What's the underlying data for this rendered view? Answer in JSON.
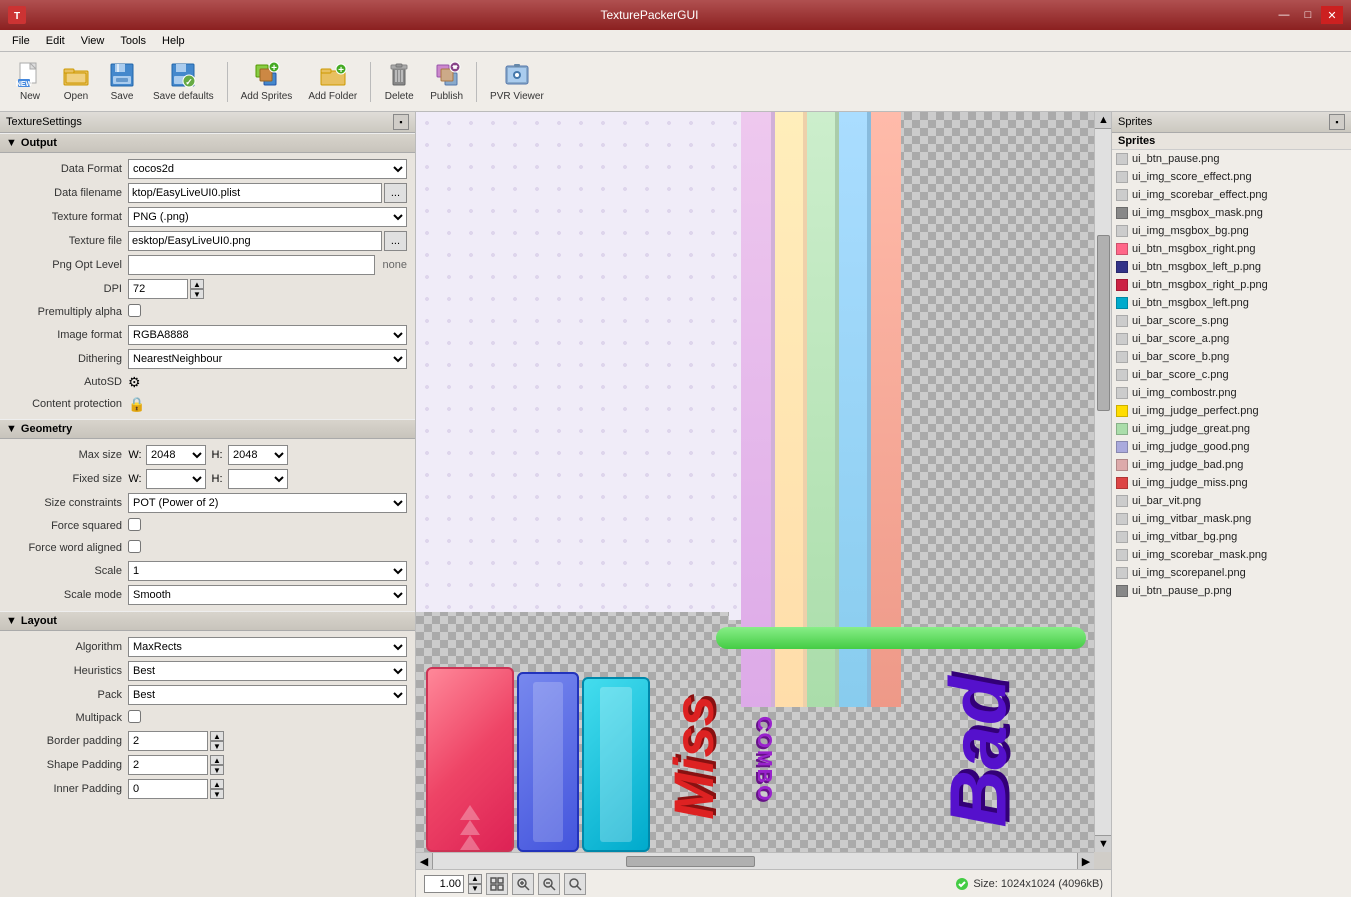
{
  "app": {
    "title": "TexturePackerGUI",
    "icon": "T"
  },
  "titlebar": {
    "minimize": "—",
    "maximize": "□",
    "close": "✕"
  },
  "menubar": {
    "items": [
      "File",
      "Edit",
      "View",
      "Tools",
      "Help"
    ]
  },
  "toolbar": {
    "buttons": [
      {
        "id": "new",
        "label": "New"
      },
      {
        "id": "open",
        "label": "Open"
      },
      {
        "id": "save",
        "label": "Save"
      },
      {
        "id": "save-defaults",
        "label": "Save defaults"
      },
      {
        "id": "add-sprites",
        "label": "Add Sprites"
      },
      {
        "id": "add-folder",
        "label": "Add Folder"
      },
      {
        "id": "delete",
        "label": "Delete"
      },
      {
        "id": "publish",
        "label": "Publish"
      },
      {
        "id": "pvr-viewer",
        "label": "PVR Viewer"
      }
    ]
  },
  "texture_settings": {
    "panel_title": "TextureSettings",
    "sections": {
      "output": {
        "label": "Output",
        "fields": {
          "data_format": {
            "label": "Data Format",
            "value": "cocos2d"
          },
          "data_filename": {
            "label": "Data filename",
            "value": "ktop/EasyLiveUI0.plist"
          },
          "texture_format": {
            "label": "Texture format",
            "value": "PNG (.png)"
          },
          "texture_file": {
            "label": "Texture file",
            "value": "esktop/EasyLiveUI0.png"
          },
          "png_opt_level": {
            "label": "Png Opt Level",
            "value": "",
            "suffix": "none"
          },
          "dpi": {
            "label": "DPI",
            "value": "72"
          },
          "premultiply_alpha": {
            "label": "Premultiply alpha",
            "checked": false
          },
          "image_format": {
            "label": "Image format",
            "value": "RGBA8888"
          },
          "dithering": {
            "label": "Dithering",
            "value": "NearestNeighbour"
          },
          "auto_sd": {
            "label": "AutoSD"
          },
          "content_protection": {
            "label": "Content protection"
          }
        }
      },
      "geometry": {
        "label": "Geometry",
        "fields": {
          "max_size_w": {
            "label": "Max size",
            "w_value": "2048",
            "h_value": "2048"
          },
          "fixed_size": {
            "label": "Fixed size",
            "w_value": "",
            "h_value": ""
          },
          "size_constraints": {
            "label": "Size constraints",
            "value": "POT (Power of 2)"
          },
          "force_squared": {
            "label": "Force squared",
            "checked": false
          },
          "force_word_aligned": {
            "label": "Force word aligned",
            "checked": false
          },
          "scale": {
            "label": "Scale",
            "value": "1"
          },
          "scale_mode": {
            "label": "Scale mode",
            "value": "Smooth"
          }
        }
      },
      "layout": {
        "label": "Layout",
        "fields": {
          "algorithm": {
            "label": "Algorithm",
            "value": "MaxRects"
          },
          "heuristics": {
            "label": "Heuristics",
            "value": "Best"
          },
          "pack": {
            "label": "Pack",
            "value": "Best"
          },
          "multipack": {
            "label": "Multipack",
            "checked": false
          },
          "border_padding": {
            "label": "Border padding",
            "value": "2"
          },
          "shape_padding": {
            "label": "Shape Padding",
            "value": "2"
          },
          "inner_padding": {
            "label": "Inner Padding",
            "value": "0"
          }
        }
      }
    }
  },
  "sprites_panel": {
    "title": "Sprites",
    "section_label": "Sprites",
    "items": [
      {
        "name": "ui_btn_pause.png",
        "color": "transparent"
      },
      {
        "name": "ui_img_score_effect.png",
        "color": "transparent"
      },
      {
        "name": "ui_img_scorebar_effect.png",
        "color": "transparent"
      },
      {
        "name": "ui_img_msgbox_mask.png",
        "color": "#888"
      },
      {
        "name": "ui_img_msgbox_bg.png",
        "color": "transparent"
      },
      {
        "name": "ui_btn_msgbox_right.png",
        "color": "#ff6688"
      },
      {
        "name": "ui_btn_msgbox_left_p.png",
        "color": "#333388"
      },
      {
        "name": "ui_btn_msgbox_right_p.png",
        "color": "#cc2244"
      },
      {
        "name": "ui_btn_msgbox_left.png",
        "color": "#00aacc"
      },
      {
        "name": "ui_bar_score_s.png",
        "color": "transparent"
      },
      {
        "name": "ui_bar_score_a.png",
        "color": "transparent"
      },
      {
        "name": "ui_bar_score_b.png",
        "color": "transparent"
      },
      {
        "name": "ui_bar_score_c.png",
        "color": "transparent"
      },
      {
        "name": "ui_img_combostr.png",
        "color": "transparent"
      },
      {
        "name": "ui_img_judge_perfect.png",
        "color": "#ffdd00"
      },
      {
        "name": "ui_img_judge_great.png",
        "color": "#aaddaa"
      },
      {
        "name": "ui_img_judge_good.png",
        "color": "#aaaadd"
      },
      {
        "name": "ui_img_judge_bad.png",
        "color": "#ddaaaa"
      },
      {
        "name": "ui_img_judge_miss.png",
        "color": "#dd4444"
      },
      {
        "name": "ui_bar_vit.png",
        "color": "transparent"
      },
      {
        "name": "ui_img_vitbar_mask.png",
        "color": "transparent"
      },
      {
        "name": "ui_img_vitbar_bg.png",
        "color": "transparent"
      },
      {
        "name": "ui_img_scorebar_mask.png",
        "color": "transparent"
      },
      {
        "name": "ui_img_scorepanel.png",
        "color": "transparent"
      },
      {
        "name": "ui_btn_pause_p.png",
        "color": "#888"
      }
    ]
  },
  "statusbar": {
    "zoom_value": "1.00",
    "size_info": "Size: 1024x1024 (4096kB)",
    "size_icon_color": "#44cc44"
  },
  "canvas": {
    "bars": [
      {
        "color": "#ddbbdd"
      },
      {
        "color": "#ffddaa"
      },
      {
        "color": "#aaddaa"
      },
      {
        "color": "#aaddff"
      },
      {
        "color": "#ffaaaa"
      },
      {
        "color": "#ffcc88"
      },
      {
        "color": "#bbddaa"
      },
      {
        "color": "#ccaaff"
      },
      {
        "color": "#ff8899"
      },
      {
        "color": "#88ccff"
      },
      {
        "color": "#ffaa88"
      },
      {
        "color": "#aaffaa"
      }
    ]
  }
}
